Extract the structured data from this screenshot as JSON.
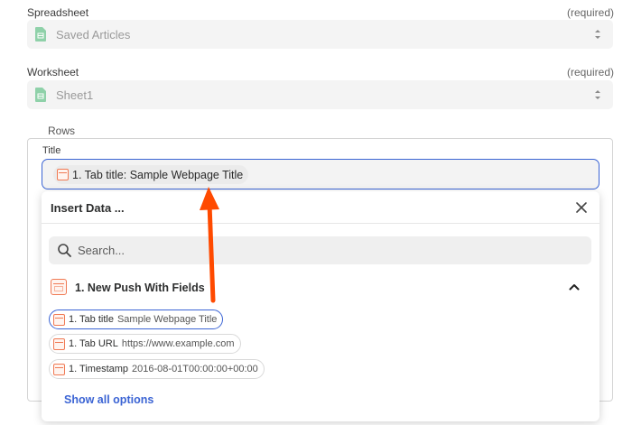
{
  "spreadsheet": {
    "label": "Spreadsheet",
    "required": "(required)",
    "value": "Saved Articles"
  },
  "worksheet": {
    "label": "Worksheet",
    "required": "(required)",
    "value": "Sheet1"
  },
  "rows": {
    "legend": "Rows",
    "title_field": {
      "label": "Title",
      "pill_key": "1. Tab title:",
      "pill_value": "Sample Webpage Title"
    }
  },
  "insert_data": {
    "title": "Insert Data ...",
    "search_placeholder": "Search...",
    "group_label": "1. New Push With Fields",
    "options": [
      {
        "key": "1. Tab title",
        "value": "Sample Webpage Title",
        "selected": true
      },
      {
        "key": "1. Tab URL",
        "value": "https://www.example.com",
        "selected": false
      },
      {
        "key": "1. Timestamp",
        "value": "2016-08-01T00:00:00+00:00",
        "selected": false
      }
    ],
    "show_all": "Show all options"
  },
  "colors": {
    "accent_blue": "#3b64d4",
    "app_orange": "#f07a54",
    "sheets_green": "#22a565",
    "arrow": "#ff4a00"
  }
}
